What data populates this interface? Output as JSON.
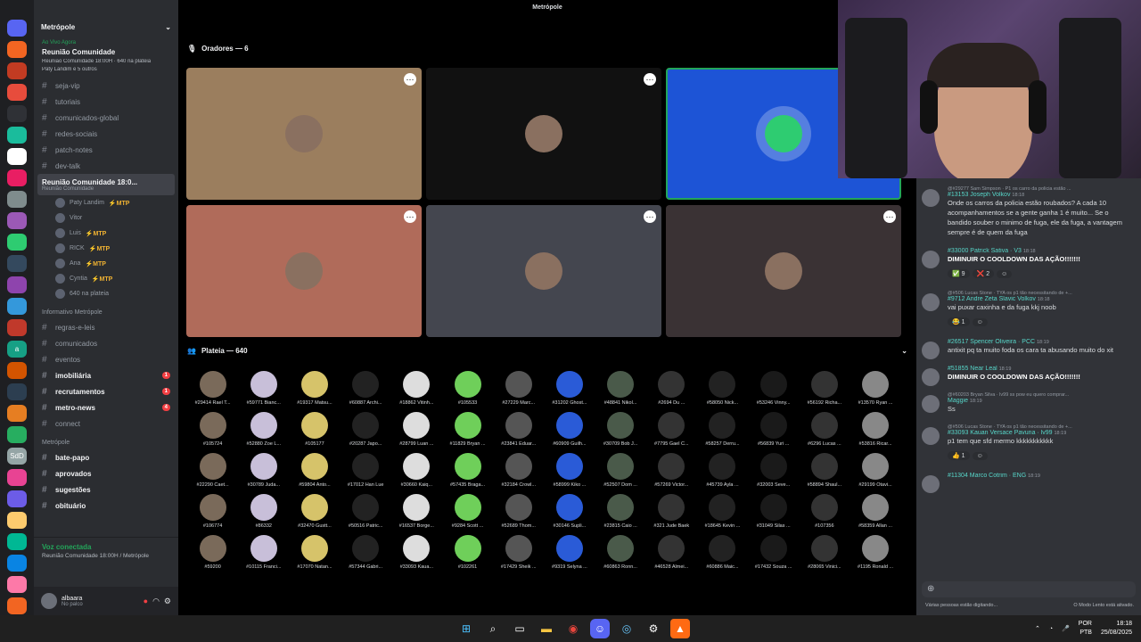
{
  "window": {
    "title": "Metrópole"
  },
  "server": {
    "name": "Metrópole",
    "live_label": "Ao Vivo Agora",
    "live_title": "Reunião Comunidade",
    "live_sub": "Reunião Comunidade 18:00H · 640 na plateia",
    "live_hosts": "Paty Landim e 5 outros",
    "novo": "NOVO"
  },
  "rail_letters": [
    "a",
    "SdD"
  ],
  "channels_top": [
    "seja-vip",
    "tutoriais",
    "comunicados-global",
    "redes-sociais",
    "patch-notes",
    "dev-talk"
  ],
  "stage_channel": {
    "name": "Reunião Comunidade 18:0...",
    "sub": "Reunião Comunidade"
  },
  "voice_users": [
    {
      "n": "Paty Landim",
      "t": "MTP"
    },
    {
      "n": "Vitor",
      "t": ""
    },
    {
      "n": "Luis",
      "t": "MTP"
    },
    {
      "n": "RICK",
      "t": "MTP"
    },
    {
      "n": "Ana",
      "t": "MTP"
    },
    {
      "n": "Cyntia",
      "t": "MTP"
    },
    {
      "n": "640 na plateia",
      "t": ""
    }
  ],
  "cat_info": "Informativo Metrópole",
  "channels_info": [
    {
      "n": "regras-e-leis",
      "b": "",
      "bold": false
    },
    {
      "n": "comunicados",
      "b": "",
      "bold": false
    },
    {
      "n": "eventos",
      "b": "",
      "bold": false
    },
    {
      "n": "imobiliária",
      "b": "1",
      "bold": true
    },
    {
      "n": "recrutamentos",
      "b": "1",
      "bold": true
    },
    {
      "n": "metro-news",
      "b": "4",
      "bold": true
    },
    {
      "n": "connect",
      "b": "",
      "bold": false
    }
  ],
  "cat_metro": "Metrópole",
  "channels_metro": [
    "bate-papo",
    "aprovados",
    "sugestões",
    "obituário"
  ],
  "voice": {
    "status": "Voz conectada",
    "channel": "Reunião Comunidade 18:00H / Metrópole"
  },
  "user": {
    "name": "albaara",
    "status": "No palco"
  },
  "stage": {
    "speakers_label": "Oradores — 6",
    "audience_label": "Plateia — 640"
  },
  "speaker_tiles": [
    {
      "bg": "#9b7e5e"
    },
    {
      "bg": "#111111"
    },
    {
      "bg": "#1d54d6"
    },
    {
      "bg": "#b06b5a"
    },
    {
      "bg": "#44464f"
    },
    {
      "bg": "#3a3234"
    }
  ],
  "audience": [
    "#29414 Rael T...",
    "#59771 Bianc...",
    "#19317 Matsu...",
    "#60887 Archi...",
    "#18862 Vitinh...",
    "#105533",
    "#27229 Marc...",
    "#31202 Ghost...",
    "#48841 Nikol...",
    "#2694 Du ...",
    "#58050 Nick...",
    "#53246 Vinny...",
    "#56192 Richa...",
    "#13570 Ryan ...",
    "#105724",
    "#52880 Zoe L...",
    "#105177",
    "#20287 Japo...",
    "#28799 Luan ...",
    "#11829 Bryan ...",
    "#23841 Eduar...",
    "#60909 Guilh...",
    "#30709 Bob J...",
    "#7795 Gael C...",
    "#58257 Derru...",
    "#56839 Yuri ...",
    "#6296 Lucas ...",
    "#53816 Ricar...",
    "#22290 Caet...",
    "#30789 Juda...",
    "#59804 Anto...",
    "#17012 Han Lue",
    "#30660 Kaiq...",
    "#57435 Braga...",
    "#32184 Crowl...",
    "#58999 Kiko ...",
    "#52507 Dom ...",
    "#57269 Victor...",
    "#45739 Ayla ...",
    "#32003 Seve...",
    "#58894 Shaul...",
    "#29199 Otavi...",
    "#106774",
    "#86332",
    "#32470 Gustt...",
    "#50516 Patric...",
    "#16537 Borge...",
    "#9284 Scott ...",
    "#52689 Thom...",
    "#30146 Supli...",
    "#23815 Caio ...",
    "#321 Jude Baek",
    "#18645 Kevin ...",
    "#31049 Silas ...",
    "#107356",
    "#58359 Allan ...",
    "#59200",
    "#10115 Franci...",
    "#17070 Natan...",
    "#57344 Gabri...",
    "#33093 Kaua...",
    "#102261",
    "#17429 Sheik ...",
    "#9319 Selyna ...",
    "#60863 Ronn...",
    "#46528 Almei...",
    "#60886 Maic...",
    "#17432 Souza ...",
    "#28065 Vinici...",
    "#1195 Ronald ..."
  ],
  "messages": [
    {
      "reply": "@#29277 Sam Simpson · P1 os carro da policia estão ...",
      "author": "#13153 Joseph Volkov",
      "time": "18:18",
      "text": "Onde os carros da policia estão roubados? A cada 10 acompanhamentos se a gente ganha 1 é muito... Se o bandido souber o minimo de fuga, ele da fuga, a vantagem sempre é de quem da fuga",
      "bold": false,
      "reacts": []
    },
    {
      "reply": "",
      "author": "#33000 Patrick Sativa · V3",
      "time": "18:18",
      "text": "DIMINUIR O COOLDOWN DAS AÇÃO!!!!!!!",
      "bold": true,
      "reacts": [
        "✅ 9",
        "❌ 2",
        "☺"
      ]
    },
    {
      "reply": "@#506 Lucas Stone · TYA os p1 tão necessitando de +...",
      "author": "#9712 Andre Zeta Slavic Volkov",
      "time": "18:18",
      "text": "vai puxar caxinha e da fuga kkj noob",
      "bold": false,
      "reacts": [
        "😂 1",
        "☺"
      ]
    },
    {
      "reply": "",
      "author": "#26517 Spencer Oliveira · PCC",
      "time": "18:19",
      "text": "antixit pq ta muito foda os cara ta abusando muito do xit",
      "bold": false,
      "reacts": []
    },
    {
      "reply": "",
      "author": "#51855 Near Leal",
      "time": "18:19",
      "text": "DIMINUIR O COOLDOWN DAS AÇÃO!!!!!!!",
      "bold": true,
      "reacts": []
    },
    {
      "reply": "@#60203 Bryan Silva · lv99 ss pow eu quero comprar...",
      "author": "Maggie",
      "time": "18:19",
      "text": "Ss",
      "bold": false,
      "reacts": []
    },
    {
      "reply": "@#506 Lucas Stone · TYA os p1 tão necessitando de +...",
      "author": "#33093 Kauan Versace Pavuna · lv99",
      "time": "18:19",
      "text": "p1 tem que sfd mermo kkkkkkkkkkk",
      "bold": false,
      "reacts": [
        "👍 1",
        "☺"
      ]
    },
    {
      "reply": "",
      "author": "#11304 Marco Cotrim · ENG",
      "time": "18:19",
      "text": "",
      "bold": false,
      "reacts": []
    }
  ],
  "composer": {
    "typing": "Várias pessoas estão digitando...",
    "slow": "O Modo Lento está ativado."
  },
  "taskbar": {
    "lang": "POR",
    "kb": "PTB",
    "time": "18:18",
    "date": "25/08/2025"
  },
  "icons": {
    "tray": [
      "chevron-up-icon",
      "wifi-icon",
      "microphone-icon"
    ]
  }
}
